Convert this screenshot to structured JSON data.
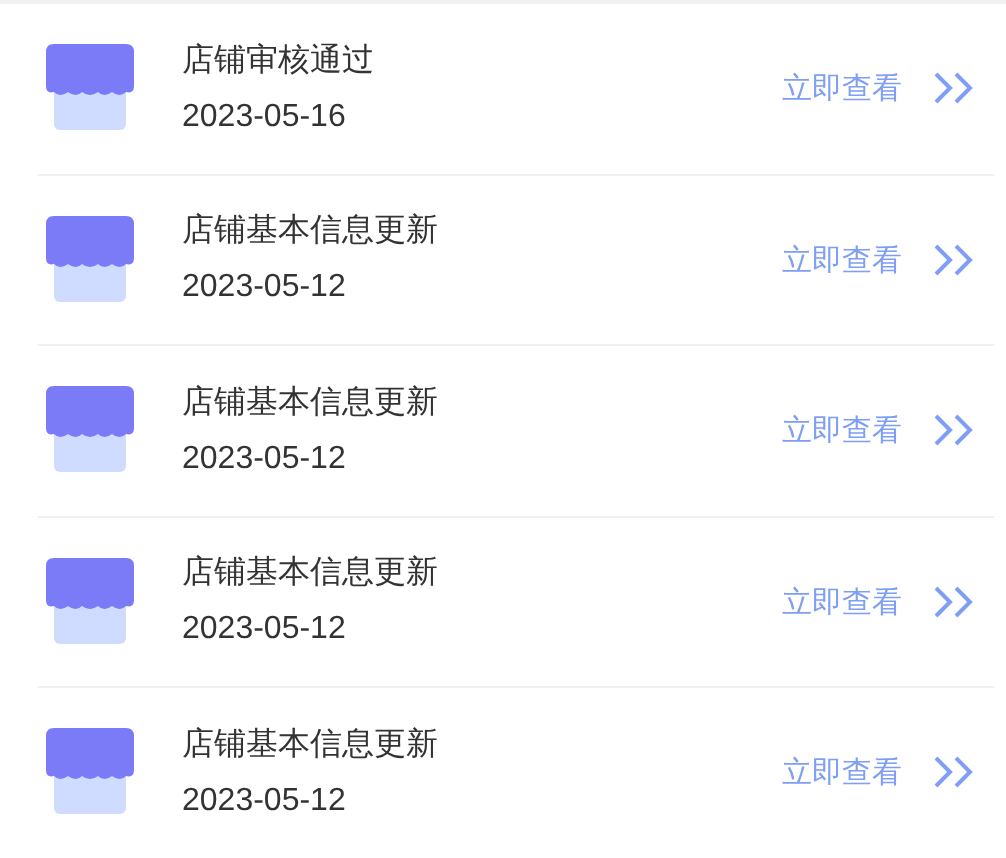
{
  "notices": [
    {
      "title": "店铺审核通过",
      "date": "2023-05-16",
      "action": "立即查看"
    },
    {
      "title": "店铺基本信息更新",
      "date": "2023-05-12",
      "action": "立即查看"
    },
    {
      "title": "店铺基本信息更新",
      "date": "2023-05-12",
      "action": "立即查看"
    },
    {
      "title": "店铺基本信息更新",
      "date": "2023-05-12",
      "action": "立即查看"
    },
    {
      "title": "店铺基本信息更新",
      "date": "2023-05-12",
      "action": "立即查看"
    }
  ]
}
